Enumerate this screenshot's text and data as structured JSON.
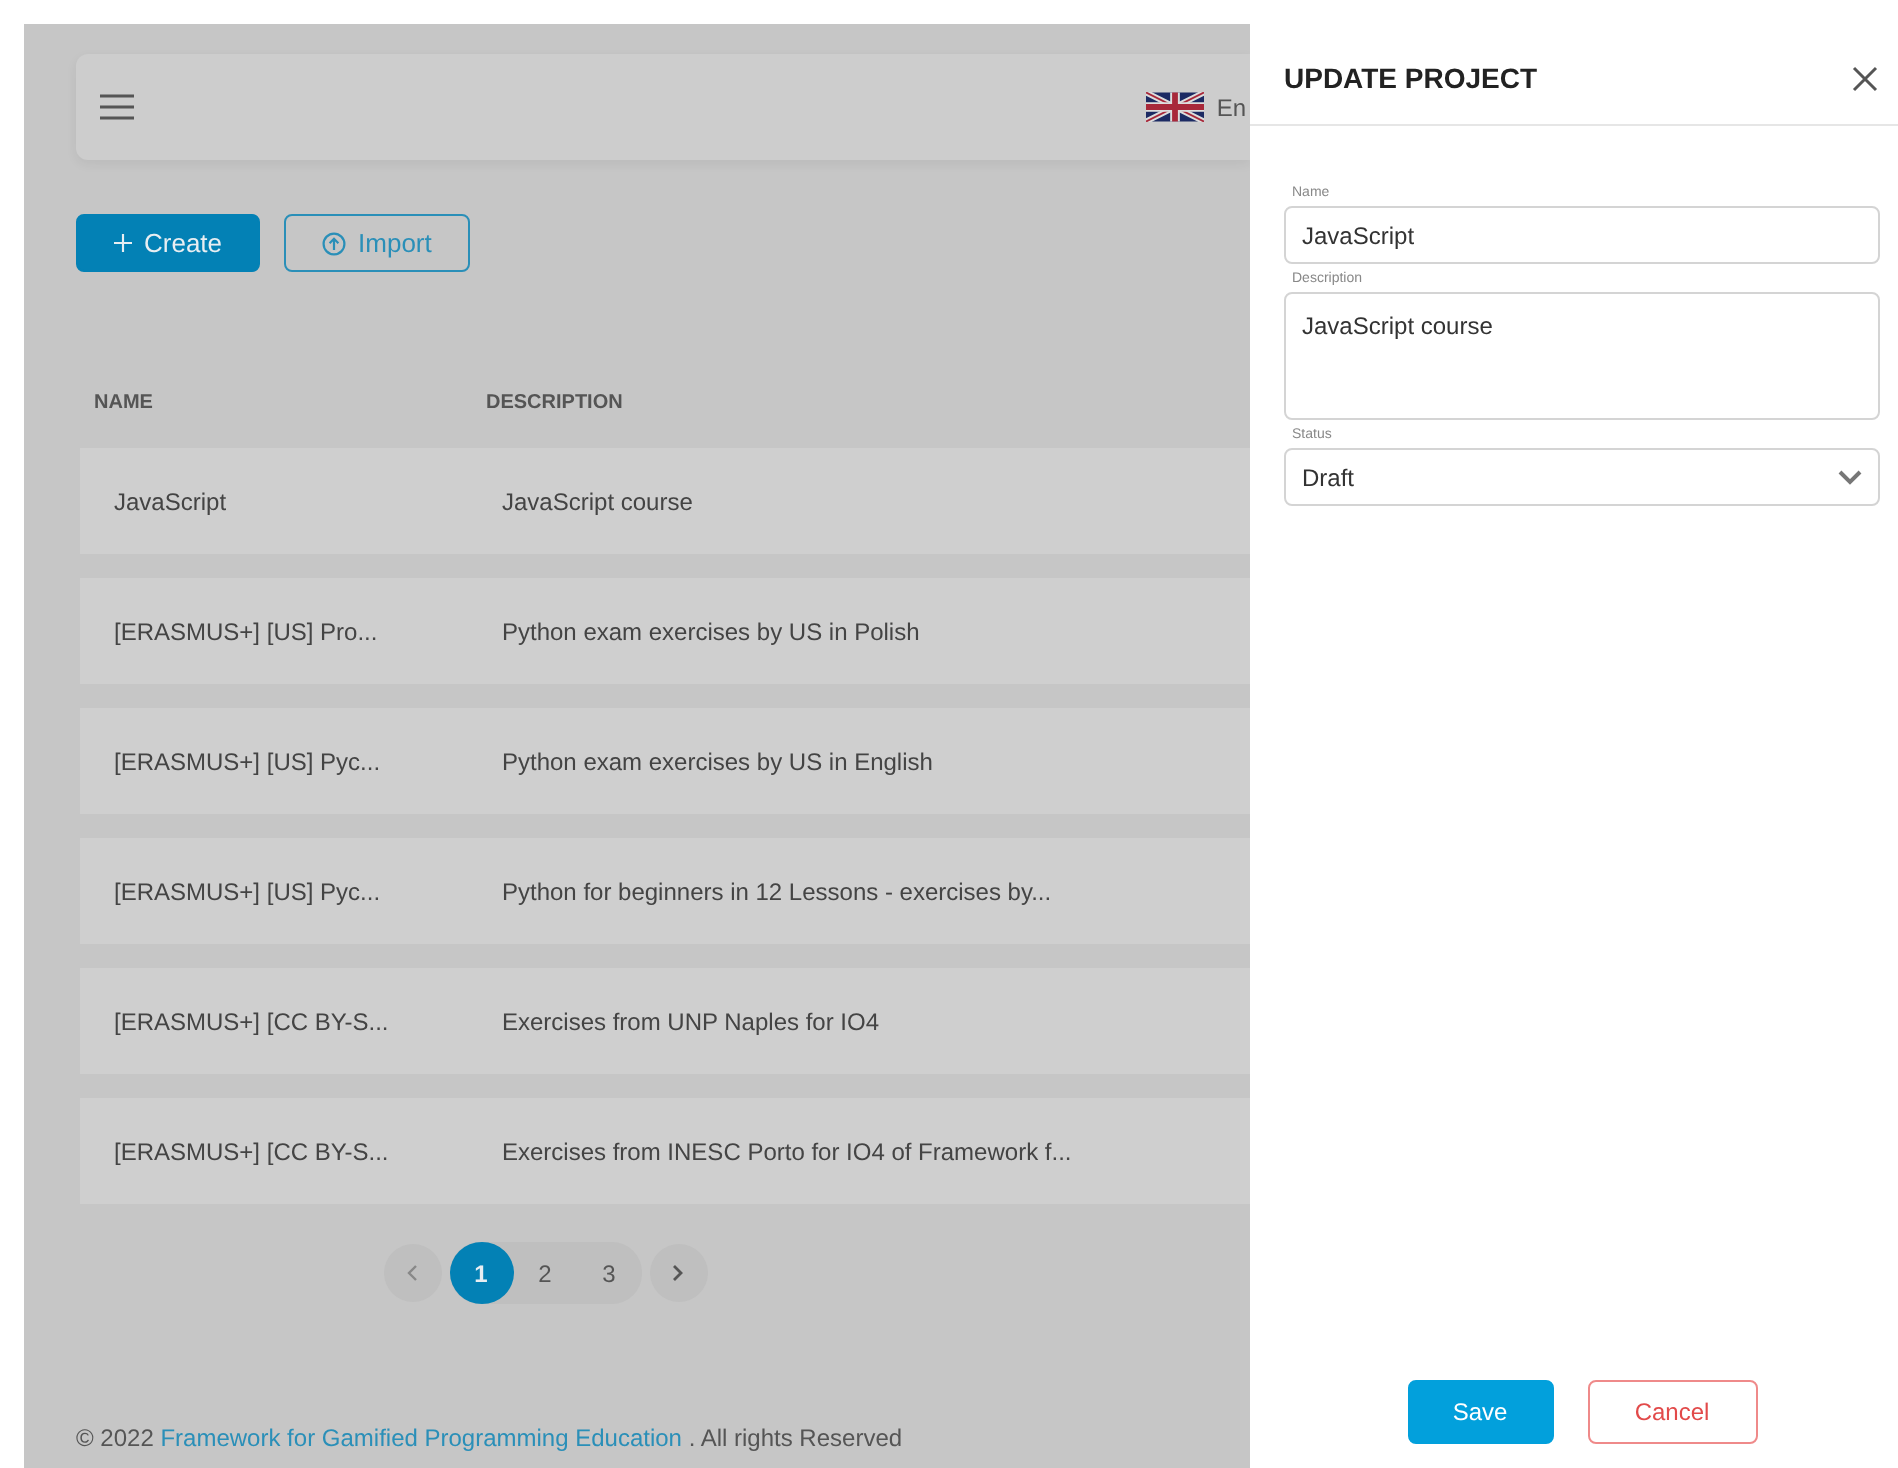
{
  "header": {
    "language": "En"
  },
  "actions": [
    {
      "kind": "primary",
      "label": "Create"
    },
    {
      "kind": "outline",
      "label": "Import"
    }
  ],
  "table": {
    "columns": [
      "NAME",
      "DESCRIPTION"
    ],
    "rows": [
      {
        "name": "JavaScript",
        "description": "JavaScript course"
      },
      {
        "name": "[ERASMUS+] [US] Pro...",
        "description": "Python exam exercises by US in Polish"
      },
      {
        "name": "[ERASMUS+] [US] Pyc...",
        "description": "Python exam exercises by US in English"
      },
      {
        "name": "[ERASMUS+] [US] Pyc...",
        "description": "Python for beginners in 12 Lessons - exercises by..."
      },
      {
        "name": "[ERASMUS+] [CC BY-S...",
        "description": "Exercises from UNP Naples for IO4"
      },
      {
        "name": "[ERASMUS+] [CC BY-S...",
        "description": "Exercises from INESC Porto for IO4 of Framework f..."
      }
    ]
  },
  "pagination": {
    "pages": [
      {
        "label": "1",
        "selected": true
      },
      {
        "label": "2",
        "selected": false
      },
      {
        "label": "3",
        "selected": false
      }
    ]
  },
  "footer": {
    "prefix": "© 2022",
    "link": "Framework for Gamified Programming Education",
    "suffix": ". All rights Reserved"
  },
  "drawer": {
    "title": "UPDATE PROJECT",
    "fields": [
      {
        "kind": "input",
        "label": "Name",
        "value": "JavaScript"
      },
      {
        "kind": "textarea",
        "label": "Description",
        "value": "JavaScript course"
      },
      {
        "kind": "select",
        "label": "Status",
        "value": "Draft"
      }
    ],
    "buttons": [
      {
        "kind": "primary",
        "label": "Save"
      },
      {
        "kind": "danger",
        "label": "Cancel"
      }
    ]
  }
}
